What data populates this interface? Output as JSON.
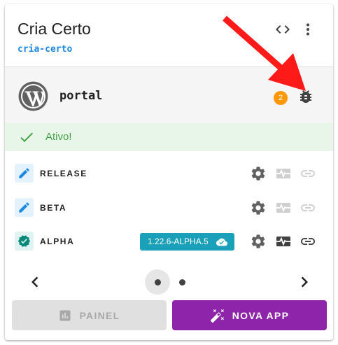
{
  "app": {
    "title": "Cria Certo",
    "slug": "cria-certo"
  },
  "header": {
    "icons": [
      "code-icon",
      "more-vert-icon"
    ]
  },
  "sub_app": {
    "name": "portal",
    "badge_count": "2",
    "icons": [
      "wordpress-logo",
      "bug-icon"
    ]
  },
  "status": {
    "text": "Ativo!",
    "color": "#43a047"
  },
  "environments": [
    {
      "name": "RELEASE",
      "icon": "pencil-icon",
      "version": "",
      "active": false
    },
    {
      "name": "BETA",
      "icon": "pencil-icon",
      "version": "",
      "active": false
    },
    {
      "name": "ALPHA",
      "icon": "verified-badge-icon",
      "version": "1.22.6-ALPHA.5",
      "active": true
    }
  ],
  "carousel": {
    "pages": 2,
    "current": 1
  },
  "buttons": {
    "painel_label": "PAINEL",
    "nova_app_label": "NOVA APP"
  },
  "colors": {
    "accent_blue": "#1e88e5",
    "version_chip": "#1aa0b8",
    "primary_purple": "#8e24aa",
    "badge_orange": "#ff9800",
    "annotation_arrow": "#ff1a1a"
  }
}
